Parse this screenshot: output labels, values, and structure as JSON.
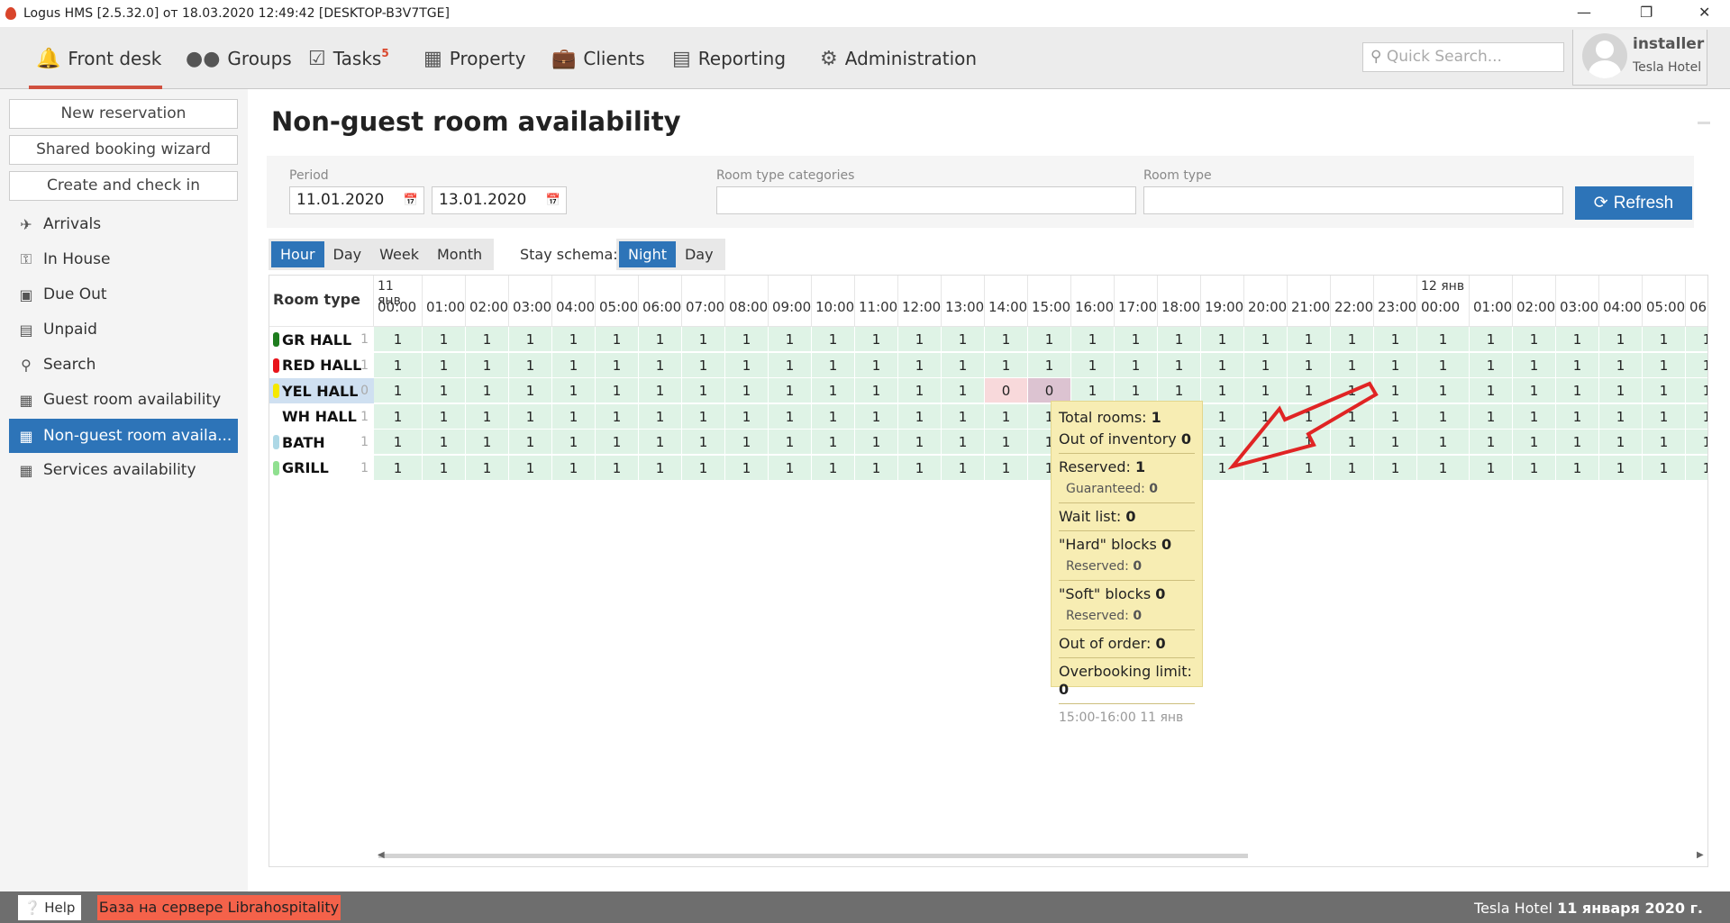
{
  "window": {
    "title": "Logus HMS [2.5.32.0] от 18.03.2020 12:49:42 [DESKTOP-B3V7TGE]"
  },
  "nav": {
    "items": [
      {
        "label": "Front desk",
        "icon": "bell-icon"
      },
      {
        "label": "Groups",
        "icon": "users-icon"
      },
      {
        "label": "Tasks",
        "icon": "calendar-check-icon",
        "badge": "5"
      },
      {
        "label": "Property",
        "icon": "building-icon"
      },
      {
        "label": "Clients",
        "icon": "briefcase-icon"
      },
      {
        "label": "Reporting",
        "icon": "bar-chart-icon"
      },
      {
        "label": "Administration",
        "icon": "gears-icon"
      }
    ],
    "search_placeholder": "Quick Search...",
    "user": {
      "name": "installer",
      "hotel": "Tesla Hotel"
    }
  },
  "sidebar": {
    "buttons": [
      "New reservation",
      "Shared booking wizard",
      "Create and check in"
    ],
    "items": [
      {
        "label": "Arrivals"
      },
      {
        "label": "In House"
      },
      {
        "label": "Due Out"
      },
      {
        "label": "Unpaid"
      },
      {
        "label": "Search"
      },
      {
        "label": "Guest room availability"
      },
      {
        "label": "Non-guest room availa..."
      },
      {
        "label": "Services availability"
      }
    ]
  },
  "page": {
    "title": "Non-guest room availability"
  },
  "filters": {
    "period_label": "Period",
    "date_from": "11.01.2020",
    "date_to": "13.01.2020",
    "categories_label": "Room type categories",
    "categories_value": "",
    "room_type_label": "Room type",
    "room_type_value": "",
    "refresh": "Refresh"
  },
  "scale": {
    "options": [
      "Hour",
      "Day",
      "Week",
      "Month"
    ],
    "selected": "Hour"
  },
  "stay": {
    "label": "Stay schema:",
    "options": [
      "Night",
      "Day"
    ],
    "selected": "Night"
  },
  "grid": {
    "room_type_header": "Room type",
    "columns": [
      {
        "date": "11 янв",
        "time": "00:00"
      },
      {
        "time": "01:00"
      },
      {
        "time": "02:00"
      },
      {
        "time": "03:00"
      },
      {
        "time": "04:00"
      },
      {
        "time": "05:00"
      },
      {
        "time": "06:00"
      },
      {
        "time": "07:00"
      },
      {
        "time": "08:00"
      },
      {
        "time": "09:00"
      },
      {
        "time": "10:00"
      },
      {
        "time": "11:00"
      },
      {
        "time": "12:00"
      },
      {
        "time": "13:00"
      },
      {
        "time": "14:00"
      },
      {
        "time": "15:00"
      },
      {
        "time": "16:00"
      },
      {
        "time": "17:00"
      },
      {
        "time": "18:00"
      },
      {
        "time": "19:00"
      },
      {
        "time": "20:00"
      },
      {
        "time": "21:00"
      },
      {
        "time": "22:00"
      },
      {
        "time": "23:00"
      },
      {
        "date": "12 янв",
        "time": "00:00"
      },
      {
        "time": "01:00"
      },
      {
        "time": "02:00"
      },
      {
        "time": "03:00"
      },
      {
        "time": "04:00"
      },
      {
        "time": "05:00"
      },
      {
        "time": "06:"
      }
    ],
    "rows": [
      {
        "name": "GR HALL",
        "count": "1",
        "color": "#1e7d1e",
        "values": [
          1,
          1,
          1,
          1,
          1,
          1,
          1,
          1,
          1,
          1,
          1,
          1,
          1,
          1,
          1,
          1,
          1,
          1,
          1,
          1,
          1,
          1,
          1,
          1,
          1,
          1,
          1,
          1,
          1,
          1,
          1
        ]
      },
      {
        "name": "RED HALL",
        "count": "1",
        "color": "#e8141b",
        "values": [
          1,
          1,
          1,
          1,
          1,
          1,
          1,
          1,
          1,
          1,
          1,
          1,
          1,
          1,
          1,
          1,
          1,
          1,
          1,
          1,
          1,
          1,
          1,
          1,
          1,
          1,
          1,
          1,
          1,
          1,
          1
        ]
      },
      {
        "name": "YEL HALL",
        "count": "0",
        "color": "#f5e800",
        "selected": true,
        "values": [
          1,
          1,
          1,
          1,
          1,
          1,
          1,
          1,
          1,
          1,
          1,
          1,
          1,
          1,
          0,
          0,
          1,
          1,
          1,
          1,
          1,
          1,
          1,
          1,
          1,
          1,
          1,
          1,
          1,
          1,
          1
        ]
      },
      {
        "name": "WH HALL",
        "count": "1",
        "color": "",
        "values": [
          1,
          1,
          1,
          1,
          1,
          1,
          1,
          1,
          1,
          1,
          1,
          1,
          1,
          1,
          1,
          1,
          1,
          1,
          1,
          1,
          1,
          1,
          1,
          1,
          1,
          1,
          1,
          1,
          1,
          1,
          1
        ]
      },
      {
        "name": "BATH",
        "count": "1",
        "color": "#add8e6",
        "values": [
          1,
          1,
          1,
          1,
          1,
          1,
          1,
          1,
          1,
          1,
          1,
          1,
          1,
          1,
          1,
          1,
          1,
          1,
          1,
          1,
          1,
          1,
          1,
          1,
          1,
          1,
          1,
          1,
          1,
          1,
          1
        ]
      },
      {
        "name": "GRILL",
        "count": "1",
        "color": "#90e090",
        "values": [
          1,
          1,
          1,
          1,
          1,
          1,
          1,
          1,
          1,
          1,
          1,
          1,
          1,
          1,
          1,
          1,
          1,
          1,
          1,
          1,
          1,
          1,
          1,
          1,
          1,
          1,
          1,
          1,
          1,
          1,
          1
        ]
      }
    ],
    "hover": {
      "row": 2,
      "col": 15
    }
  },
  "tooltip": {
    "total_label": "Total rooms:",
    "total": "1",
    "ooi_label": "Out of inventory",
    "ooi": "0",
    "reserved_label": "Reserved:",
    "reserved": "1",
    "guaranteed_label": "Guaranteed:",
    "guaranteed": "0",
    "wait_label": "Wait list:",
    "wait": "0",
    "hard_label": "\"Hard\" blocks",
    "hard": "0",
    "hard_res_label": "Reserved:",
    "hard_res": "0",
    "soft_label": "\"Soft\" blocks ",
    "soft": "0",
    "soft_res_label": "Reserved:",
    "soft_res": "0",
    "ooo_label": "Out of order:",
    "ooo": "0",
    "overbook_label": "Overbooking limit:",
    "overbook": "0",
    "period": "15:00-16:00 11 янв"
  },
  "footer": {
    "help": "Help",
    "db": "База на сервере Librahospitality",
    "hotel": "Tesla Hotel",
    "date": "11 января 2020 г."
  },
  "colors": {
    "accent": "#2d74b8",
    "cell": "#dff3e6",
    "zero": "#f8d9db",
    "hover": "#dcc3d1",
    "nav_underline": "#d0503f"
  }
}
